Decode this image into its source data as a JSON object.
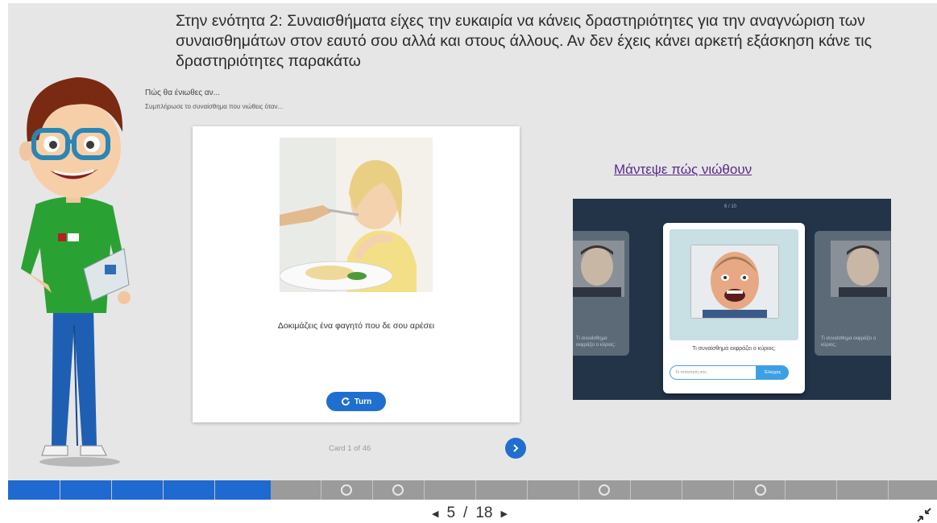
{
  "heading": "Στην ενότητα 2: Συναισθήματα είχες την ευκαιρία να κάνεις δραστηριότητες για την αναγνώριση των συναισθημάτων στον εαυτό σου αλλά και στους άλλους. Αν δεν έχεις κάνει αρκετή εξάσκηση κάνε τις δραστηριότητες παρακάτω",
  "activity": {
    "title": "Πώς θα ένιωθες αν...",
    "instruction": "Συμπλήρωσε το συναίσθημα που νιώθεις όταν..."
  },
  "flashcard": {
    "text": "Δοκιμάζεις ένα φαγητό που δε σου αρέσει",
    "turn_label": "Turn",
    "counter": "Card 1 of 46"
  },
  "link_text": "Μάντεψε πώς νιώθουν",
  "preview": {
    "counter": "6 / 10",
    "question": "Τι συναίσθημα εκφράζει ο κύριος;",
    "input_placeholder": "Το απάντησή σου",
    "check_label": "Έλεγχος",
    "left_text": "Τι συναίσθημα εκφράζει ο κύριος;",
    "right_text": "Τι συναίσθημα εκφράζει ο κύριος;"
  },
  "navigation": {
    "current": "5",
    "separator": "/",
    "total": "18"
  },
  "progress": {
    "completed_fraction": 0.283
  },
  "colors": {
    "accent": "#1e6ad0",
    "link": "#5a2a8a",
    "preview_bg": "#233448"
  },
  "icons": [
    "refresh-icon",
    "chevron-right-icon",
    "triangle-left-icon",
    "triangle-right-icon",
    "exit-fullscreen-icon"
  ]
}
